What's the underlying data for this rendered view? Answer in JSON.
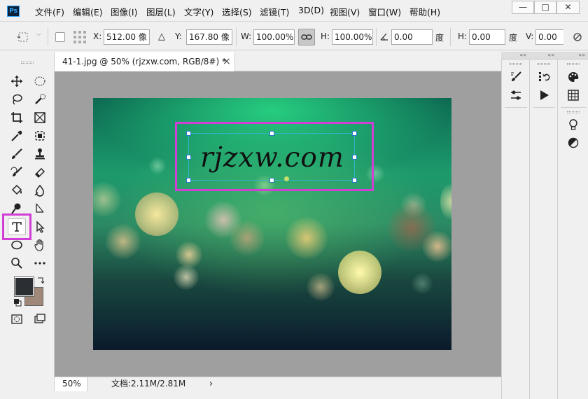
{
  "app": {
    "logo": "Ps"
  },
  "menu": [
    "文件(F)",
    "编辑(E)",
    "图像(I)",
    "图层(L)",
    "文字(Y)",
    "选择(S)",
    "滤镜(T)",
    "3D(D)",
    "视图(V)",
    "窗口(W)",
    "帮助(H)"
  ],
  "window_controls": {
    "minimize": "—",
    "restore": "□",
    "close": "✕"
  },
  "options": {
    "x_label": "X:",
    "x_value": "512.00 像",
    "y_label": "Y:",
    "y_value": "167.80 像",
    "w_label": "W:",
    "w_value": "100.00%",
    "h_label": "H:",
    "h_value": "100.00%",
    "angle_value": "0.00",
    "angle_unit": "度",
    "h2_label": "H:",
    "h2_value": "0.00",
    "h2_unit": "度",
    "v_label": "V:",
    "v_value": "0.00"
  },
  "document": {
    "tab_title": "41-1.jpg @ 50% (rjzxw.com, RGB/8#) *",
    "tab_close": "×",
    "text_layer": "rjzxw.com"
  },
  "status": {
    "zoom": "50%",
    "doc_info": "文档:2.11M/2.81M",
    "arrow": "›"
  },
  "colors": {
    "foreground": "#2b2f33",
    "background": "#a08878",
    "highlight": "#d23fd6",
    "selection": "#30b5c4"
  },
  "toolbar_icons": [
    "move-icon",
    "elliptical-marquee-icon",
    "lasso-icon",
    "quick-selection-icon",
    "crop-icon",
    "frame-icon",
    "eyedropper-icon",
    "spot-healing-icon",
    "brush-icon",
    "clone-stamp-icon",
    "history-brush-icon",
    "eraser-icon",
    "paint-bucket-icon",
    "blur-icon",
    "dodge-icon",
    "pen-icon",
    "type-icon",
    "path-selection-icon",
    "ellipse-icon",
    "hand-icon",
    "zoom-icon",
    "more-tools-icon",
    "quick-mask-icon",
    "screen-mode-icon"
  ]
}
